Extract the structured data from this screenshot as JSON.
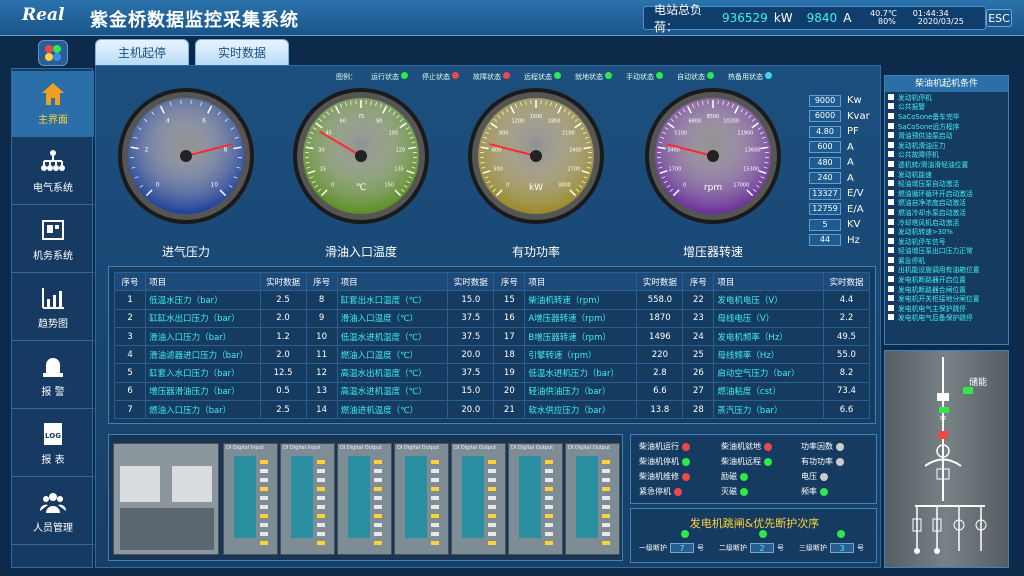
{
  "header": {
    "logo": "Real",
    "title": "紫金桥数据监控采集系统",
    "load_label": "电站总负荷：",
    "load_kw": "936529",
    "unit_kw": "kW",
    "load_a": "9840",
    "unit_a": "A",
    "temp": "40.7℃",
    "humidity": "80%",
    "time": "01:44:34",
    "date": "2020/03/25",
    "esc": "ESC"
  },
  "tabs": [
    "主机起停",
    "实时数据"
  ],
  "sidebar": [
    {
      "label": "主界面",
      "icon": "home-icon"
    },
    {
      "label": "电气系统",
      "icon": "network-icon"
    },
    {
      "label": "机务系统",
      "icon": "machine-icon"
    },
    {
      "label": "趋势图",
      "icon": "chart-icon"
    },
    {
      "label": "报 警",
      "icon": "alarm-icon"
    },
    {
      "label": "报 表",
      "icon": "log-icon"
    },
    {
      "label": "人员管理",
      "icon": "users-icon"
    }
  ],
  "legend": {
    "title": "图例：",
    "items": [
      {
        "label": "运行状态",
        "color": "#2fe84a"
      },
      {
        "label": "停止状态",
        "color": "#e84a4a"
      },
      {
        "label": "故障状态",
        "color": "#e84a4a"
      },
      {
        "label": "远程状态",
        "color": "#2fe84a"
      },
      {
        "label": "就地状态",
        "color": "#2fe84a"
      },
      {
        "label": "手动状态",
        "color": "#2fe84a"
      },
      {
        "label": "自动状态",
        "color": "#2fe84a"
      },
      {
        "label": "热备用状态",
        "color": "#3cd6f0"
      }
    ]
  },
  "gauges": [
    {
      "label": "进气压力",
      "face": "#1c3f9a",
      "ticks": [
        "0",
        "2",
        "4",
        "6",
        "8",
        "10"
      ],
      "unit": "",
      "value_frac": 0.78
    },
    {
      "label": "滑油入口温度",
      "face": "#5b8f22",
      "ticks": [
        "0",
        "15",
        "30",
        "45",
        "60",
        "75",
        "90",
        "105",
        "120",
        "135",
        "150"
      ],
      "unit": "℃",
      "value_frac": 0.28
    },
    {
      "label": "有功功率",
      "face": "#9a8a2a",
      "ticks": [
        "0",
        "300",
        "600",
        "900",
        "1200",
        "1500",
        "1800",
        "2100",
        "2400",
        "2700",
        "3000"
      ],
      "unit": "kW",
      "value_frac": 0.22
    },
    {
      "label": "增压器转速",
      "face": "#6a2f9a",
      "ticks": [
        "0",
        "1700",
        "3400",
        "5100",
        "6800",
        "8500",
        "10200",
        "11900",
        "13600",
        "15300",
        "17000"
      ],
      "unit": "rpm",
      "value_frac": 0.22
    }
  ],
  "readings": [
    {
      "value": "9000",
      "unit": "Kw"
    },
    {
      "value": "6000",
      "unit": "Kvar"
    },
    {
      "value": "4.80",
      "unit": "PF"
    },
    {
      "value": "600",
      "unit": "A"
    },
    {
      "value": "480",
      "unit": "A"
    },
    {
      "value": "240",
      "unit": "A"
    },
    {
      "value": "13327",
      "unit": "E/V"
    },
    {
      "value": "12759",
      "unit": "E/A"
    },
    {
      "value": "5",
      "unit": "KV"
    },
    {
      "value": "44",
      "unit": "Hz"
    }
  ],
  "table": {
    "headers": [
      "序号",
      "项目",
      "实时数据"
    ],
    "rows": [
      [
        [
          "1",
          "低温水压力（bar）",
          "2.5"
        ],
        [
          "8",
          "缸套出水口温度（℃）",
          "15.0"
        ],
        [
          "15",
          "柴油机转速（rpm）",
          "558.0"
        ],
        [
          "22",
          "发电机电压（V）",
          "4.4"
        ]
      ],
      [
        [
          "2",
          "缸缸水出口压力（bar）",
          "2.0"
        ],
        [
          "9",
          "滑油入口温度（℃）",
          "37.5"
        ],
        [
          "16",
          "A增压器转速（rpm）",
          "1870"
        ],
        [
          "23",
          "母线电压（V）",
          "2.2"
        ]
      ],
      [
        [
          "3",
          "滑油入口压力（bar）",
          "1.2"
        ],
        [
          "10",
          "低温水进机温度（℃）",
          "37.5"
        ],
        [
          "17",
          "B增压器转速（rpm）",
          "1496"
        ],
        [
          "24",
          "发电机频率（Hz）",
          "49.5"
        ]
      ],
      [
        [
          "4",
          "滑油滤器进口压力（bar）",
          "2.0"
        ],
        [
          "11",
          "燃油入口温度（℃）",
          "20.0"
        ],
        [
          "18",
          "引擎转速（rpm）",
          "220"
        ],
        [
          "25",
          "母线频率（Hz）",
          "55.0"
        ]
      ],
      [
        [
          "5",
          "缸套入水口压力（bar）",
          "12.5"
        ],
        [
          "12",
          "高温水出机温度（℃）",
          "37.5"
        ],
        [
          "19",
          "低温水进机压力（bar）",
          "2.8"
        ],
        [
          "26",
          "启动空气压力（bar）",
          "8.2"
        ]
      ],
      [
        [
          "6",
          "增压器滑油压力（bar）",
          "0.5"
        ],
        [
          "13",
          "高温水进机温度（℃）",
          "15.0"
        ],
        [
          "20",
          "轻油供油压力（bar）",
          "6.6"
        ],
        [
          "27",
          "燃油粘度（cst）",
          "73.4"
        ]
      ],
      [
        [
          "7",
          "燃油入口压力（bar）",
          "2.5"
        ],
        [
          "14",
          "燃油进机温度（℃）",
          "20.0"
        ],
        [
          "21",
          "软水供应压力（bar）",
          "13.8"
        ],
        [
          "28",
          "蒸汽压力（bar）",
          "6.6"
        ]
      ]
    ]
  },
  "plc_modules": [
    "DI Digital Input",
    "DI Digital Input",
    "DI Digital Output",
    "DI Digital Output",
    "DI Digital Output",
    "DI Digital Output",
    "DI Digital Output"
  ],
  "status": [
    {
      "label": "柴油机运行",
      "color": "#e84a4a"
    },
    {
      "label": "柴油机就地",
      "color": "#e84a4a"
    },
    {
      "label": "功率因数",
      "color": "#cccccc"
    },
    {
      "label": "柴油机停机",
      "color": "#2fe84a"
    },
    {
      "label": "柴油机远程",
      "color": "#2fe84a"
    },
    {
      "label": "有功功率",
      "color": "#cccccc"
    },
    {
      "label": "柴油机维修",
      "color": "#e84a4a"
    },
    {
      "label": "励磁",
      "color": "#2fe84a"
    },
    {
      "label": "电压",
      "color": "#cccccc"
    },
    {
      "label": "紧急停机",
      "color": "#e84a4a"
    },
    {
      "label": "灭磁",
      "color": "#2fe84a"
    },
    {
      "label": "频率",
      "color": "#2fe84a"
    }
  ],
  "trip": {
    "title": "发电机跳闸&优先断护次序",
    "items": [
      {
        "label": "一级断护",
        "value": "7",
        "unit": "号"
      },
      {
        "label": "二级断护",
        "value": "2",
        "unit": "号"
      },
      {
        "label": "三级断护",
        "value": "3",
        "unit": "号"
      }
    ]
  },
  "conditions": {
    "title": "柴油机起机条件",
    "items": [
      "发动机停机",
      "公共报警",
      "SaCoSone备车完毕",
      "SaCoSone远方程序",
      "滑油预供油泵启动",
      "发动机滑油压力",
      "公共故障停机",
      "透机转/滑油滑轻油位置",
      "发动机能速",
      "轻油增压泵自动激活",
      "燃油循环循环开启动激活",
      "燃油自净浓度启动激活",
      "燃油冷却水泵启动激活",
      "冷却塔风机启动激活",
      "发动机转速>30%",
      "发动机停车信号",
      "轻油增压泵出口压力正常",
      "紧急停机",
      "出机能设施调用有油箱位置",
      "发电机断路器开启位置",
      "发电机断路器合闸位置",
      "发电机开关柜接地分闸位置",
      "发电机电气主保护跳停",
      "发电机电气后备保护跳停"
    ]
  },
  "single_line": {
    "label": "储能"
  }
}
